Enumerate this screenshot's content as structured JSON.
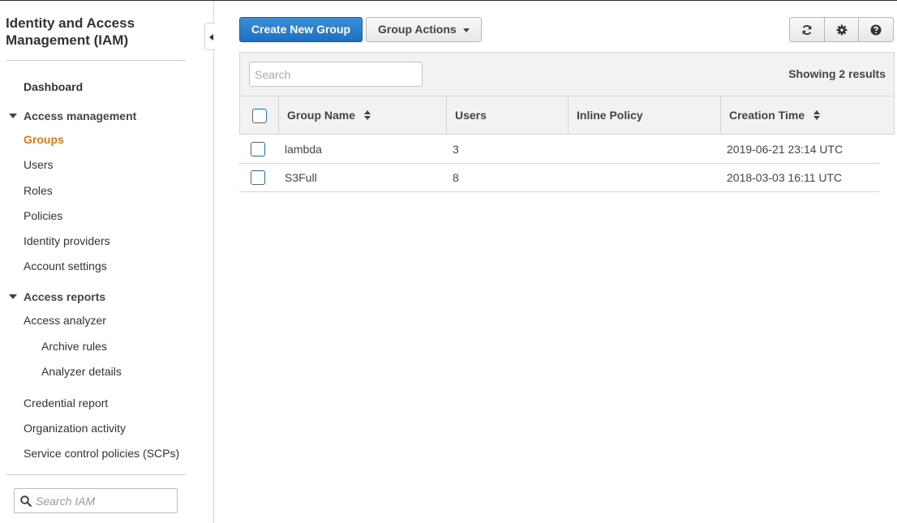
{
  "sidebar": {
    "service_title": "Identity and Access Management (IAM)",
    "dashboard": "Dashboard",
    "access_management": {
      "label": "Access management",
      "items": [
        "Groups",
        "Users",
        "Roles",
        "Policies",
        "Identity providers",
        "Account settings"
      ],
      "active": "Groups"
    },
    "access_reports": {
      "label": "Access reports",
      "analyzer": "Access analyzer",
      "analyzer_subitems": [
        "Archive rules",
        "Analyzer details"
      ],
      "items": [
        "Credential report",
        "Organization activity",
        "Service control policies (SCPs)"
      ]
    },
    "search": {
      "placeholder": "Search IAM"
    }
  },
  "toolbar": {
    "create_label": "Create New Group",
    "actions_label": "Group Actions",
    "icons": [
      "refresh-icon",
      "gear-icon",
      "help-icon"
    ]
  },
  "table": {
    "search_placeholder": "Search",
    "results_text": "Showing 2 results",
    "columns": [
      "Group Name",
      "Users",
      "Inline Policy",
      "Creation Time"
    ],
    "rows": [
      {
        "name": "lambda",
        "users": "3",
        "inline_policy": "",
        "created": "2019-06-21 23:14 UTC"
      },
      {
        "name": "S3Full",
        "users": "8",
        "inline_policy": "",
        "created": "2018-03-03 16:11 UTC"
      }
    ]
  },
  "colors": {
    "primary": "#1f6fc0",
    "active_nav": "#e47911",
    "checkbox": "#2b6fb5"
  }
}
